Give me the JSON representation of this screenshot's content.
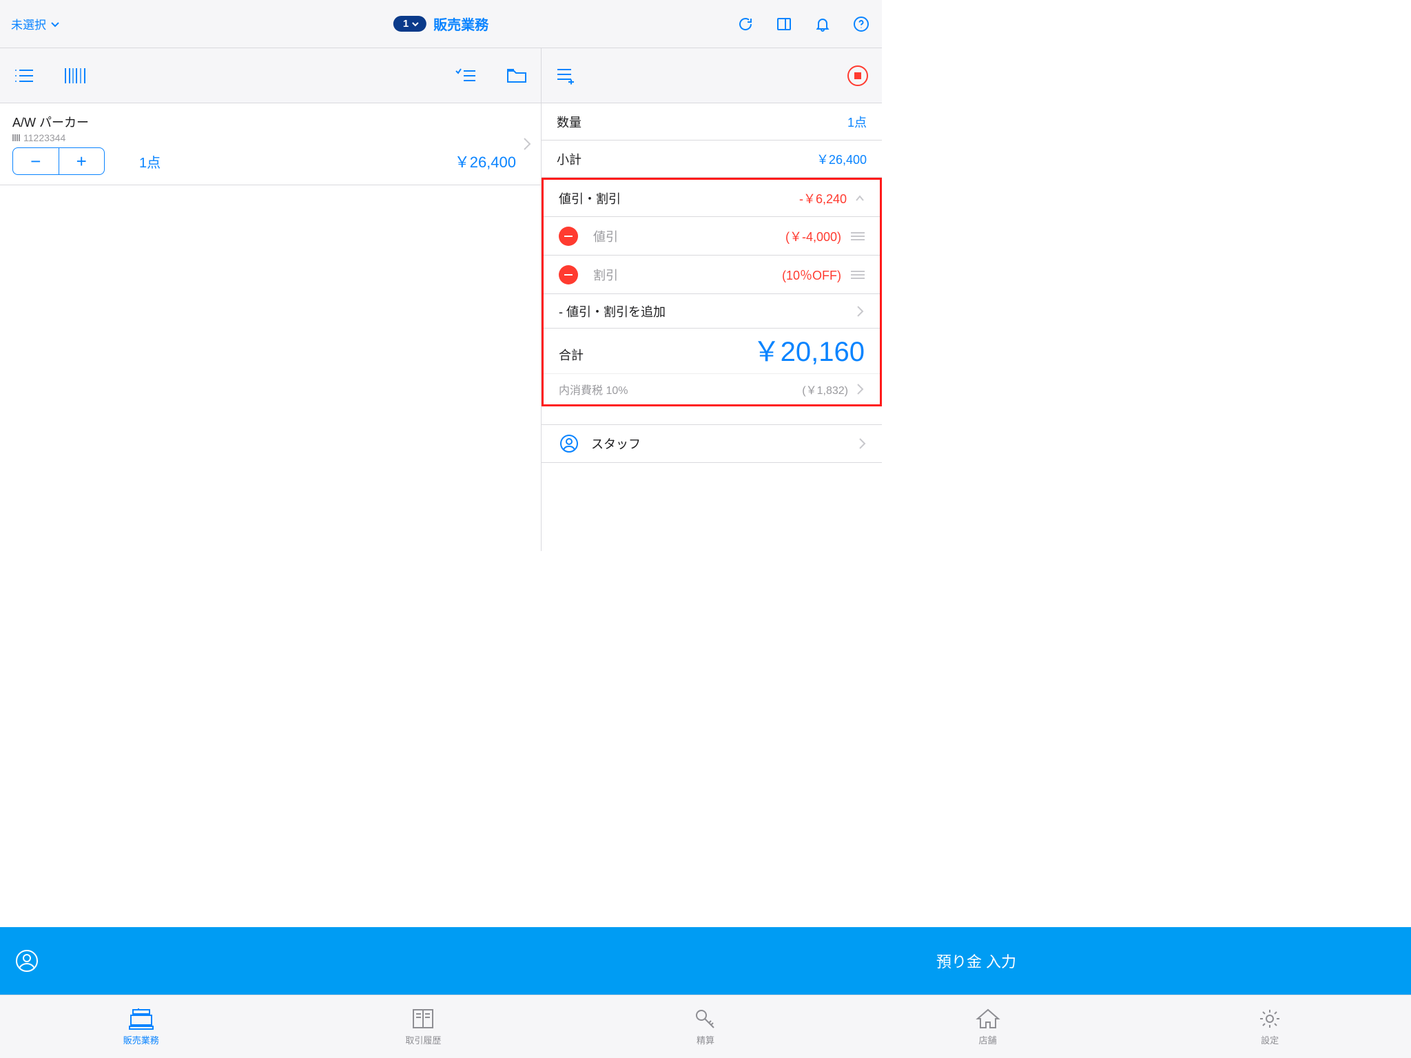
{
  "top": {
    "selector": "未選択",
    "pill_count": "1",
    "title": "販売業務"
  },
  "item": {
    "name": "A/W パーカー",
    "code": "11223344",
    "qty": "1点",
    "price": "￥26,400"
  },
  "summary": {
    "qty_label": "数量",
    "qty_value": "1点",
    "subtotal_label": "小計",
    "subtotal_value": "￥26,400",
    "discount_label": "値引・割引",
    "discount_value": "-￥6,240",
    "disc_items": {
      "0": {
        "label": "値引",
        "amount": "(￥-4,000)"
      },
      "1": {
        "label": "割引",
        "amount": "(10％OFF)"
      }
    },
    "add_discount": "- 値引・割引を追加",
    "total_label": "合計",
    "total_value": "￥20,160",
    "tax_label": "内消費税 10%",
    "tax_value": "(￥1,832)",
    "staff_label": "スタッフ"
  },
  "action": {
    "deposit": "預り金 入力"
  },
  "tabs": {
    "sales": "販売業務",
    "history": "取引履歴",
    "settlement": "精算",
    "store": "店舗",
    "settings": "設定"
  }
}
